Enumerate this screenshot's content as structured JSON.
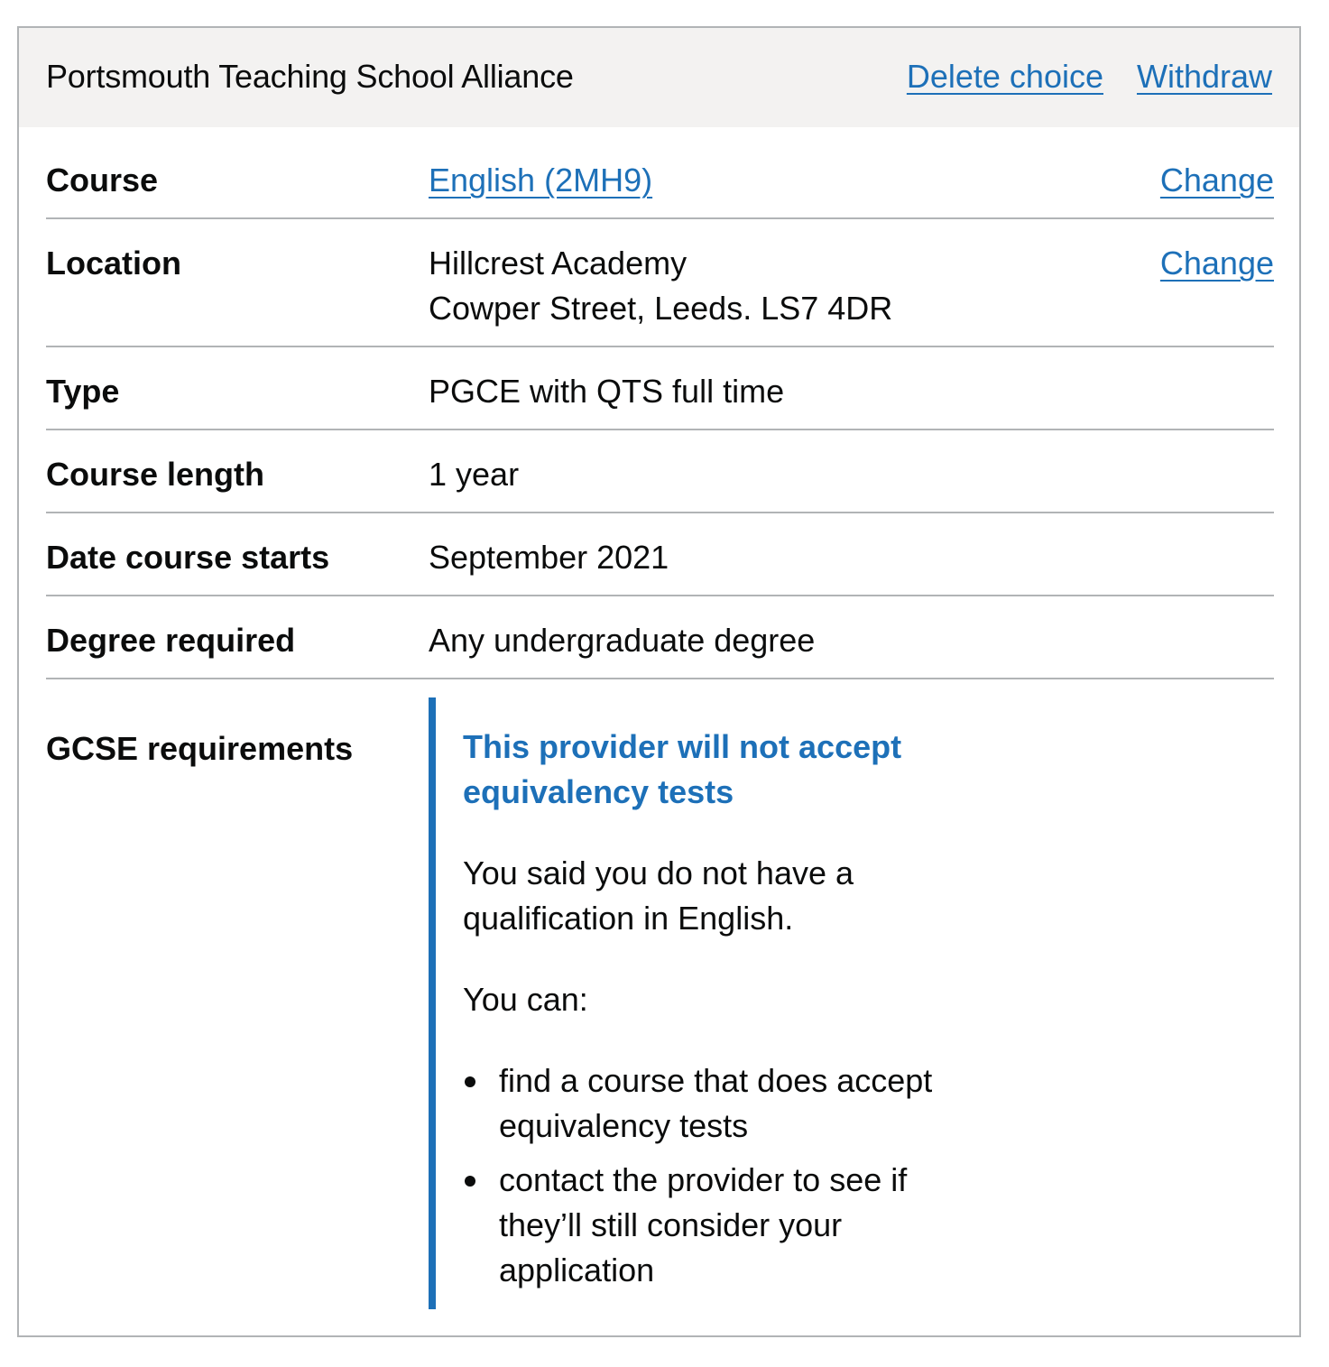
{
  "card": {
    "title": "Portsmouth Teaching School Alliance",
    "actions": {
      "delete_label": "Delete choice",
      "withdraw_label": "Withdraw"
    }
  },
  "summary": {
    "course": {
      "key": "Course",
      "value": "English (2MH9)",
      "action": "Change"
    },
    "location": {
      "key": "Location",
      "value_line1": "Hillcrest Academy",
      "value_line2": "Cowper Street, Leeds. LS7 4DR",
      "action": "Change"
    },
    "type": {
      "key": "Type",
      "value": "PGCE with QTS full time"
    },
    "course_length": {
      "key": "Course length",
      "value": "1 year"
    },
    "date_course_starts": {
      "key": "Date course starts",
      "value": "September 2021"
    },
    "degree_required": {
      "key": "Degree required",
      "value": "Any undergraduate degree"
    },
    "gcse_requirements": {
      "key": "GCSE requirements",
      "inset": {
        "heading": "This provider will not accept equivalency tests",
        "paragraph": "You said you do not have a qualification in English.",
        "intro": "You can:",
        "options": [
          "find a course that does accept equivalency tests",
          "contact the provider to see if they’ll still consider your application"
        ]
      }
    }
  },
  "colors": {
    "link": "#1d70b8",
    "text": "#0b0c0c",
    "header_background": "#f3f2f1",
    "border": "#b1b4b6"
  }
}
